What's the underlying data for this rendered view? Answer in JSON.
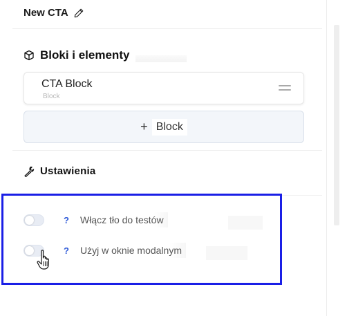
{
  "header": {
    "title": "New CTA"
  },
  "blocks_section": {
    "title": "Bloki i elementy",
    "blocks": [
      {
        "name": "CTA Block",
        "type": "Block"
      }
    ],
    "add_button": {
      "plus": "+",
      "label": "Block"
    }
  },
  "settings_section": {
    "title": "Ustawienia",
    "toggles": [
      {
        "help": "?",
        "label": "Włącz tło do testów",
        "on": false
      },
      {
        "help": "?",
        "label": "Użyj w oknie modalnym",
        "on": false
      }
    ]
  },
  "colors": {
    "highlight_border": "#1a1fe6",
    "help_icon": "#2f5bd8",
    "add_button_bg": "#f3f6fa"
  },
  "icons": {
    "header": "pencil-icon",
    "blocks_section": "cube-icon",
    "settings_section": "wrench-icon",
    "block_drag": "drag-handle-icon",
    "cursor": "hand-pointer-icon"
  }
}
